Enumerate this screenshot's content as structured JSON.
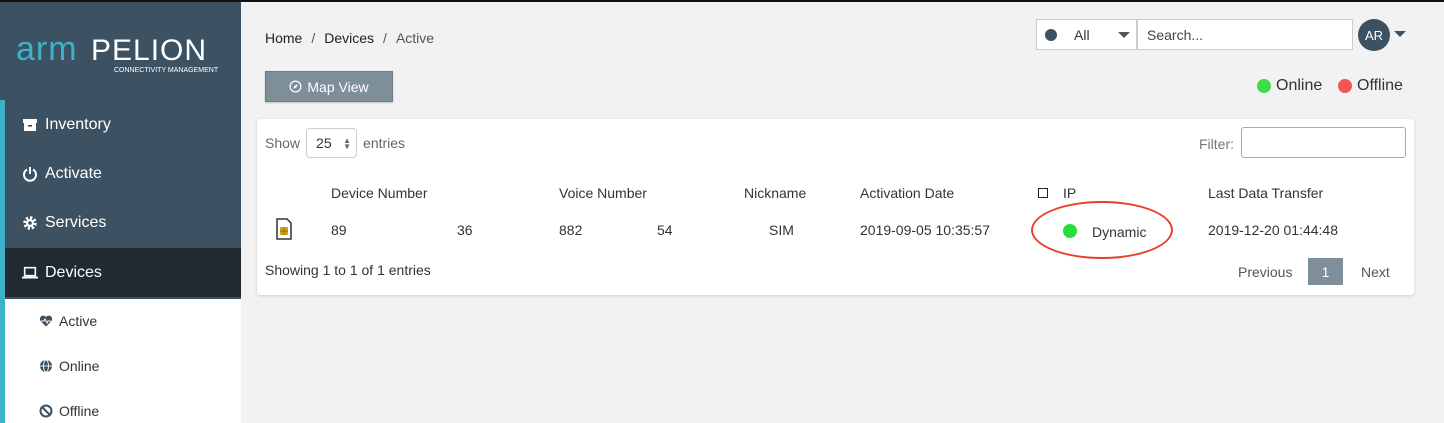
{
  "brand": {
    "logo_arm": "arm",
    "logo_name": "PELION",
    "logo_tagline": "CONNECTIVITY MANAGEMENT"
  },
  "sidebar": {
    "items": [
      {
        "label": "Inventory",
        "icon": "archive-icon"
      },
      {
        "label": "Activate",
        "icon": "power-icon"
      },
      {
        "label": "Services",
        "icon": "gear-icon"
      },
      {
        "label": "Devices",
        "icon": "laptop-icon",
        "active": true
      }
    ],
    "sub_items": [
      {
        "label": "Active",
        "icon": "heartbeat-icon"
      },
      {
        "label": "Online",
        "icon": "globe-icon"
      },
      {
        "label": "Offline",
        "icon": "ban-icon"
      }
    ]
  },
  "breadcrumb": {
    "items": [
      "Home",
      "Devices",
      "Active"
    ],
    "separator": "/"
  },
  "toolbar": {
    "map_view_label": "Map View",
    "status_filter_value": "All",
    "search_placeholder": "Search...",
    "avatar_initials": "AR"
  },
  "legend": {
    "online_label": "Online",
    "offline_label": "Offline",
    "online_color": "#3fdc4a",
    "offline_color": "#f25656"
  },
  "table": {
    "show_label": "Show",
    "entries_value": "25",
    "entries_label": "entries",
    "filter_label": "Filter:",
    "columns": [
      "Device Number",
      "Voice Number",
      "Nickname",
      "Activation Date",
      "IP",
      "Last Data Transfer"
    ],
    "rows": [
      {
        "device_number_start": "89",
        "device_number_end": "36",
        "voice_number_start": "882",
        "voice_number_end": "54",
        "nickname": "SIM",
        "activation_date": "2019-09-05 10:35:57",
        "ip": "Dynamic",
        "last_data_transfer": "2019-12-20 01:44:48"
      }
    ],
    "info": "Showing 1 to 1 of 1 entries",
    "pagination": {
      "previous": "Previous",
      "current": "1",
      "next": "Next"
    }
  },
  "colors": {
    "sidebar": "#3c5263",
    "sidebar_active": "#222a31",
    "accent": "#3bb2c7",
    "button": "#7f8f9a",
    "status_online": "#22e038",
    "highlight_ellipse": "#e8402a"
  }
}
